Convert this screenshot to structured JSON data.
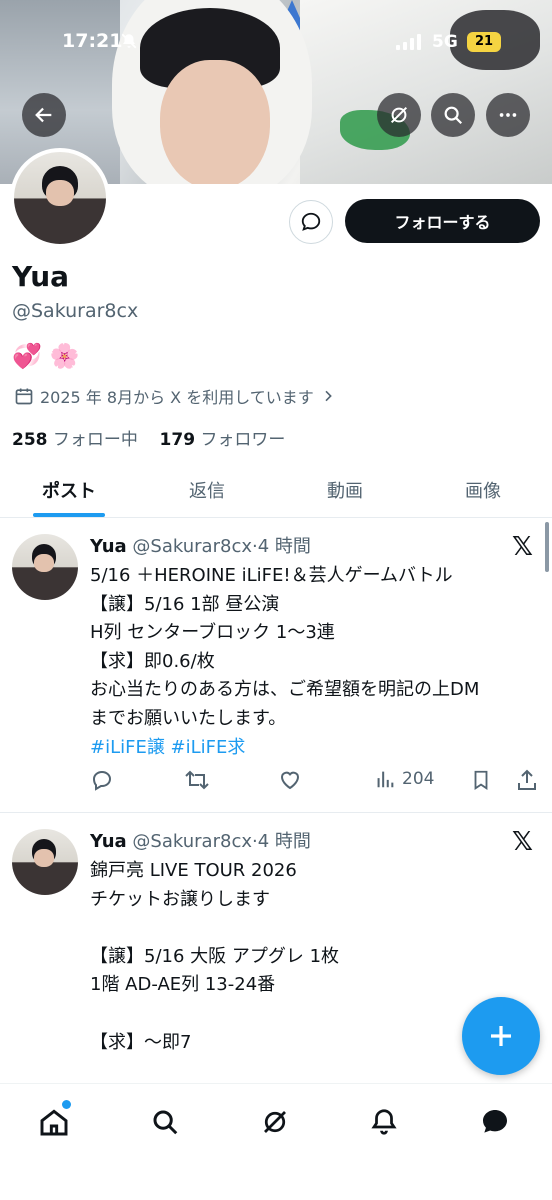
{
  "status_bar": {
    "time": "17:21",
    "network": "5G",
    "battery": "21"
  },
  "profile": {
    "name": "Yua",
    "handle": "@Sakurar8cx",
    "bio": "💞 🌸",
    "joined": "2025 年 8月から X を利用しています",
    "following_count": "258",
    "following_label": "フォロー中",
    "followers_count": "179",
    "followers_label": "フォロワー",
    "follow_button": "フォローする"
  },
  "tabs": [
    {
      "label": "ポスト",
      "active": true
    },
    {
      "label": "返信",
      "active": false
    },
    {
      "label": "動画",
      "active": false
    },
    {
      "label": "画像",
      "active": false
    }
  ],
  "posts": [
    {
      "name": "Yua",
      "handle": "@Sakurar8cx",
      "time": "·4 時間",
      "text": "5/16 ＋HEROINE iLiFE!＆芸人ゲームバトル\n【譲】5/16 1部 昼公演\nH列 センターブロック 1〜3連\n【求】即0.6/枚\nお心当たりのある方は、ご希望額を明記の上DM\nまでお願いいたします。",
      "hashtags": "#iLiFE譲 #iLiFE求",
      "views": "204"
    },
    {
      "name": "Yua",
      "handle": "@Sakurar8cx",
      "time": "·4 時間",
      "text": "錦戸亮 LIVE TOUR 2026\nチケットお譲りします\n\n【譲】5/16 大阪 アプグレ 1枚\n1階 AD-AE列 13-24番\n\n【求】〜即7"
    }
  ],
  "colors": {
    "accent": "#1d9bf0",
    "text": "#0f1419",
    "secondary": "#536471",
    "follow_bg": "#0f1419"
  }
}
